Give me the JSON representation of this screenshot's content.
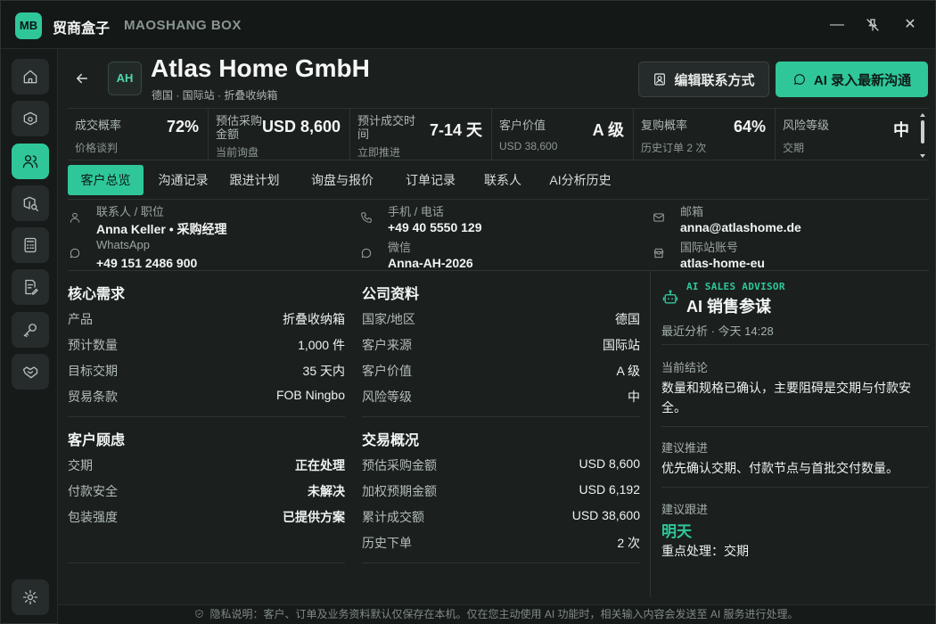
{
  "app": {
    "logo": "MB",
    "name": "贸商盒子",
    "subtitle": "MAOSHANG BOX"
  },
  "window_controls": {
    "minimize": "—",
    "pin": "pin-icon",
    "close": "✕"
  },
  "sidebar": {
    "items": [
      {
        "icon": "home-icon"
      },
      {
        "icon": "box-gear-icon"
      },
      {
        "icon": "users-icon",
        "active": true
      },
      {
        "icon": "package-search-icon"
      },
      {
        "icon": "calculator-icon"
      },
      {
        "icon": "document-edit-icon"
      },
      {
        "icon": "key-icon"
      },
      {
        "icon": "handshake-icon"
      }
    ],
    "settings_icon": "gear-icon"
  },
  "customer": {
    "avatar": "AH",
    "name": "Atlas Home GmbH",
    "meta": "德国 · 国际站 · 折叠收纳箱"
  },
  "actions": {
    "edit_label": "编辑联系方式",
    "ai_label": "AI 录入最新沟通"
  },
  "kpis": [
    {
      "label": "成交概率",
      "sub": "价格谈判",
      "value": "72%"
    },
    {
      "label": "预估采购金额",
      "sub": "当前询盘",
      "value": "USD 8,600"
    },
    {
      "label": "预计成交时间",
      "sub": "立即推进",
      "value": "7-14 天"
    },
    {
      "label": "客户价值",
      "sub": "USD 38,600",
      "value": "A 级"
    },
    {
      "label": "复购概率",
      "sub": "历史订单 2 次",
      "value": "64%"
    },
    {
      "label": "风险等级",
      "sub": "交期",
      "value": "中"
    }
  ],
  "tabs": [
    {
      "label": "客户总览",
      "active": true
    },
    {
      "label": "沟通记录"
    },
    {
      "label": "跟进计划"
    },
    {
      "label": "询盘与报价"
    },
    {
      "label": "订单记录"
    },
    {
      "label": "联系人"
    },
    {
      "label": "AI分析历史"
    }
  ],
  "contacts": [
    {
      "icon": "user-icon",
      "key": "联系人 / 职位",
      "value": "Anna Keller • 采购经理"
    },
    {
      "icon": "phone-icon",
      "key": "手机 / 电话",
      "value": "+49 40 5550 129"
    },
    {
      "icon": "mail-icon",
      "key": "邮箱",
      "value": "anna@atlashome.de"
    },
    {
      "icon": "chat-icon",
      "key": "WhatsApp",
      "value": "+49 151 2486 900"
    },
    {
      "icon": "chat-icon",
      "key": "微信",
      "value": "Anna-AH-2026"
    },
    {
      "icon": "store-icon",
      "key": "国际站账号",
      "value": "atlas-home-eu"
    }
  ],
  "core_needs": {
    "title": "核心需求",
    "rows": [
      {
        "k": "产品",
        "v": "折叠收纳箱"
      },
      {
        "k": "预计数量",
        "v": "1,000 件"
      },
      {
        "k": "目标交期",
        "v": "35 天内"
      },
      {
        "k": "贸易条款",
        "v": "FOB Ningbo"
      }
    ]
  },
  "company": {
    "title": "公司资料",
    "rows": [
      {
        "k": "国家/地区",
        "v": "德国"
      },
      {
        "k": "客户来源",
        "v": "国际站"
      },
      {
        "k": "客户价值",
        "v": "A 级"
      },
      {
        "k": "风险等级",
        "v": "中"
      }
    ]
  },
  "concerns": {
    "title": "客户顾虑",
    "rows": [
      {
        "k": "交期",
        "v": "正在处理"
      },
      {
        "k": "付款安全",
        "v": "未解决"
      },
      {
        "k": "包装强度",
        "v": "已提供方案"
      }
    ]
  },
  "deal": {
    "title": "交易概况",
    "rows": [
      {
        "k": "预估采购金额",
        "v": "USD 8,600"
      },
      {
        "k": "加权预期金额",
        "v": "USD 6,192"
      },
      {
        "k": "累计成交额",
        "v": "USD 38,600"
      },
      {
        "k": "历史下单",
        "v": "2 次"
      }
    ]
  },
  "ai": {
    "tag": "AI SALES ADVISOR",
    "title": "AI 销售参谋",
    "time": "最近分析 · 今天 14:28",
    "conclusion_label": "当前结论",
    "conclusion": "数量和规格已确认，主要阻碍是交期与付款安全。",
    "suggest_label": "建议推进",
    "suggest": "优先确认交期、付款节点与首批交付数量。",
    "follow_label": "建议跟进",
    "follow_when": "明天",
    "follow_focus": "重点处理：交期"
  },
  "footer": "隐私说明：客户、订单及业务资料默认仅保存在本机。仅在您主动使用 AI 功能时，相关输入内容会发送至 AI 服务进行处理。",
  "colors": {
    "accent": "#2fc79a",
    "background": "#1b201f"
  }
}
